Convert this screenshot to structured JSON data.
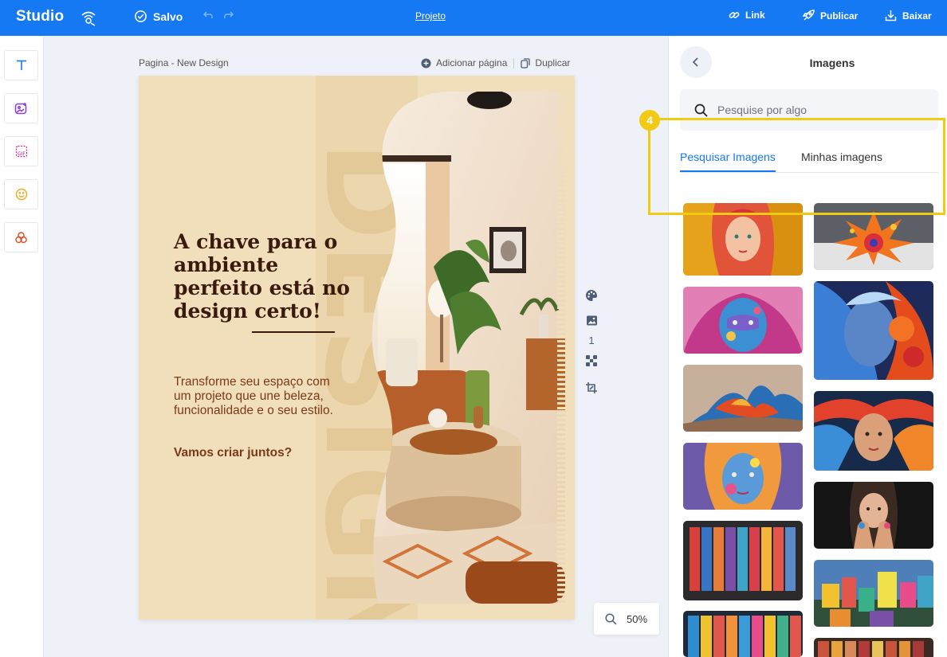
{
  "topbar": {
    "logo": "Studio",
    "saved_label": "Salvo",
    "project_label": "Projeto",
    "link_label": "Link",
    "publish_label": "Publicar",
    "download_label": "Baixar",
    "bg_color": "#1679f4"
  },
  "left_tools": [
    {
      "name": "text-tool",
      "icon": "text-T-icon"
    },
    {
      "name": "image-tool",
      "icon": "image-add-icon"
    },
    {
      "name": "gif-tool",
      "icon": "gif-icon"
    },
    {
      "name": "emoji-tool",
      "icon": "smiley-icon"
    },
    {
      "name": "elements-tool",
      "icon": "shapes-icon"
    }
  ],
  "canvas": {
    "page_label": "Pagina - New Design",
    "add_page_label": "Adicionar página",
    "duplicate_label": "Duplicar",
    "page_number": "1",
    "zoom": "50%"
  },
  "design": {
    "headline": "A chave para o ambiente perfeito está no design certo!",
    "paragraph": "Transforme seu espaço com um projeto que une beleza, funcionalidade e o seu estilo.",
    "cta": "Vamos criar juntos?",
    "vertical_word": "DESIGN",
    "bg_color": "#f1dfbc",
    "text_color": "#3a1a0d",
    "accent_text_color": "#7a3a18"
  },
  "panel": {
    "title": "Imagens",
    "search_placeholder": "Pesquise por algo",
    "tabs": [
      {
        "label": "Pesquisar Imagens",
        "active": true
      },
      {
        "label": "Minhas imagens",
        "active": false
      }
    ],
    "step_badge": "4",
    "highlight_color": "#f1cb13"
  }
}
